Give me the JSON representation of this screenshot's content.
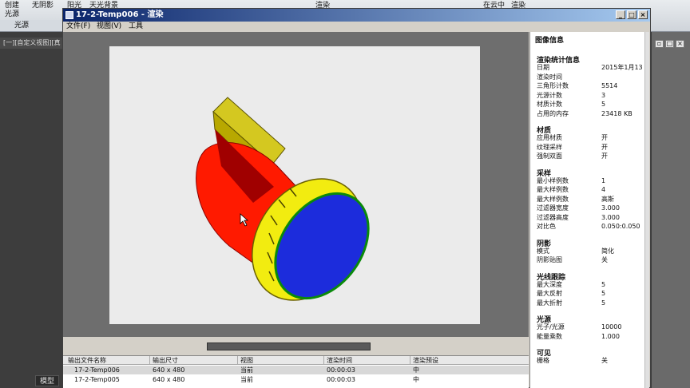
{
  "ribbon": {
    "items": [
      "创建\n光源",
      "无阴影",
      "阳光",
      "天光背景",
      "渲染",
      "在云中",
      "渲染"
    ],
    "panel": "光源",
    "viewport_label": "[一][自定义视图][真"
  },
  "window": {
    "title": "17-2-Temp006 - 渲染",
    "buttons": {
      "minimize": "_",
      "maximize": "□",
      "close": "×"
    }
  },
  "menu": [
    "文件(F)",
    "视图(V)",
    "工具"
  ],
  "info": {
    "title": "图像信息",
    "sections": [
      {
        "heading": "渲染统计信息",
        "rows": [
          {
            "label": "日期",
            "value": "2015年1月13"
          },
          {
            "label": "渲染时间",
            "value": ""
          },
          {
            "label": "三角形计数",
            "value": "5514"
          },
          {
            "label": "光源计数",
            "value": "3"
          },
          {
            "label": "材质计数",
            "value": "5"
          },
          {
            "label": "占用的内存",
            "value": "23418 KB"
          }
        ]
      },
      {
        "heading": "材质",
        "rows": [
          {
            "label": "应用材质",
            "value": "开"
          },
          {
            "label": "纹理采样",
            "value": "开"
          },
          {
            "label": "强制双面",
            "value": "开"
          }
        ]
      },
      {
        "heading": "采样",
        "rows": [
          {
            "label": "最小样例数",
            "value": "1"
          },
          {
            "label": "最大样例数",
            "value": "4"
          },
          {
            "label": "最大样例数",
            "value": "高斯"
          },
          {
            "label": "过滤器宽度",
            "value": "3.000"
          },
          {
            "label": "过滤器高度",
            "value": "3.000"
          },
          {
            "label": "对比色",
            "value": "0.050:0.050"
          }
        ]
      },
      {
        "heading": "阴影",
        "rows": [
          {
            "label": "模式",
            "value": "简化"
          },
          {
            "label": "阴影贴图",
            "value": "关"
          }
        ]
      },
      {
        "heading": "光线跟踪",
        "rows": [
          {
            "label": "最大深度",
            "value": "5"
          },
          {
            "label": "最大反射",
            "value": "5"
          },
          {
            "label": "最大折射",
            "value": "5"
          }
        ]
      },
      {
        "heading": "光源",
        "rows": [
          {
            "label": "光子/光源",
            "value": "10000"
          },
          {
            "label": "能量乘数",
            "value": "1.000"
          }
        ]
      },
      {
        "heading": "可见",
        "rows": [
          {
            "label": "栅格",
            "value": "关"
          }
        ]
      }
    ]
  },
  "history": {
    "columns": [
      "输出文件名称",
      "输出尺寸",
      "视图",
      "渲染时间",
      "渲染预设"
    ],
    "rows": [
      [
        "17-2-Temp006",
        "640 x 480",
        "当前",
        "00:00:03",
        "中"
      ],
      [
        "17-2-Temp005",
        "640 x 480",
        "当前",
        "00:00:03",
        "中"
      ]
    ]
  },
  "bottom_tab": "模型",
  "colors": {
    "title_start": "#0a246a",
    "title_end": "#a6caf0",
    "body_red": "#ff1a00",
    "lens_blue": "#1c2cdc",
    "rim_yellow": "#f2ec10"
  }
}
